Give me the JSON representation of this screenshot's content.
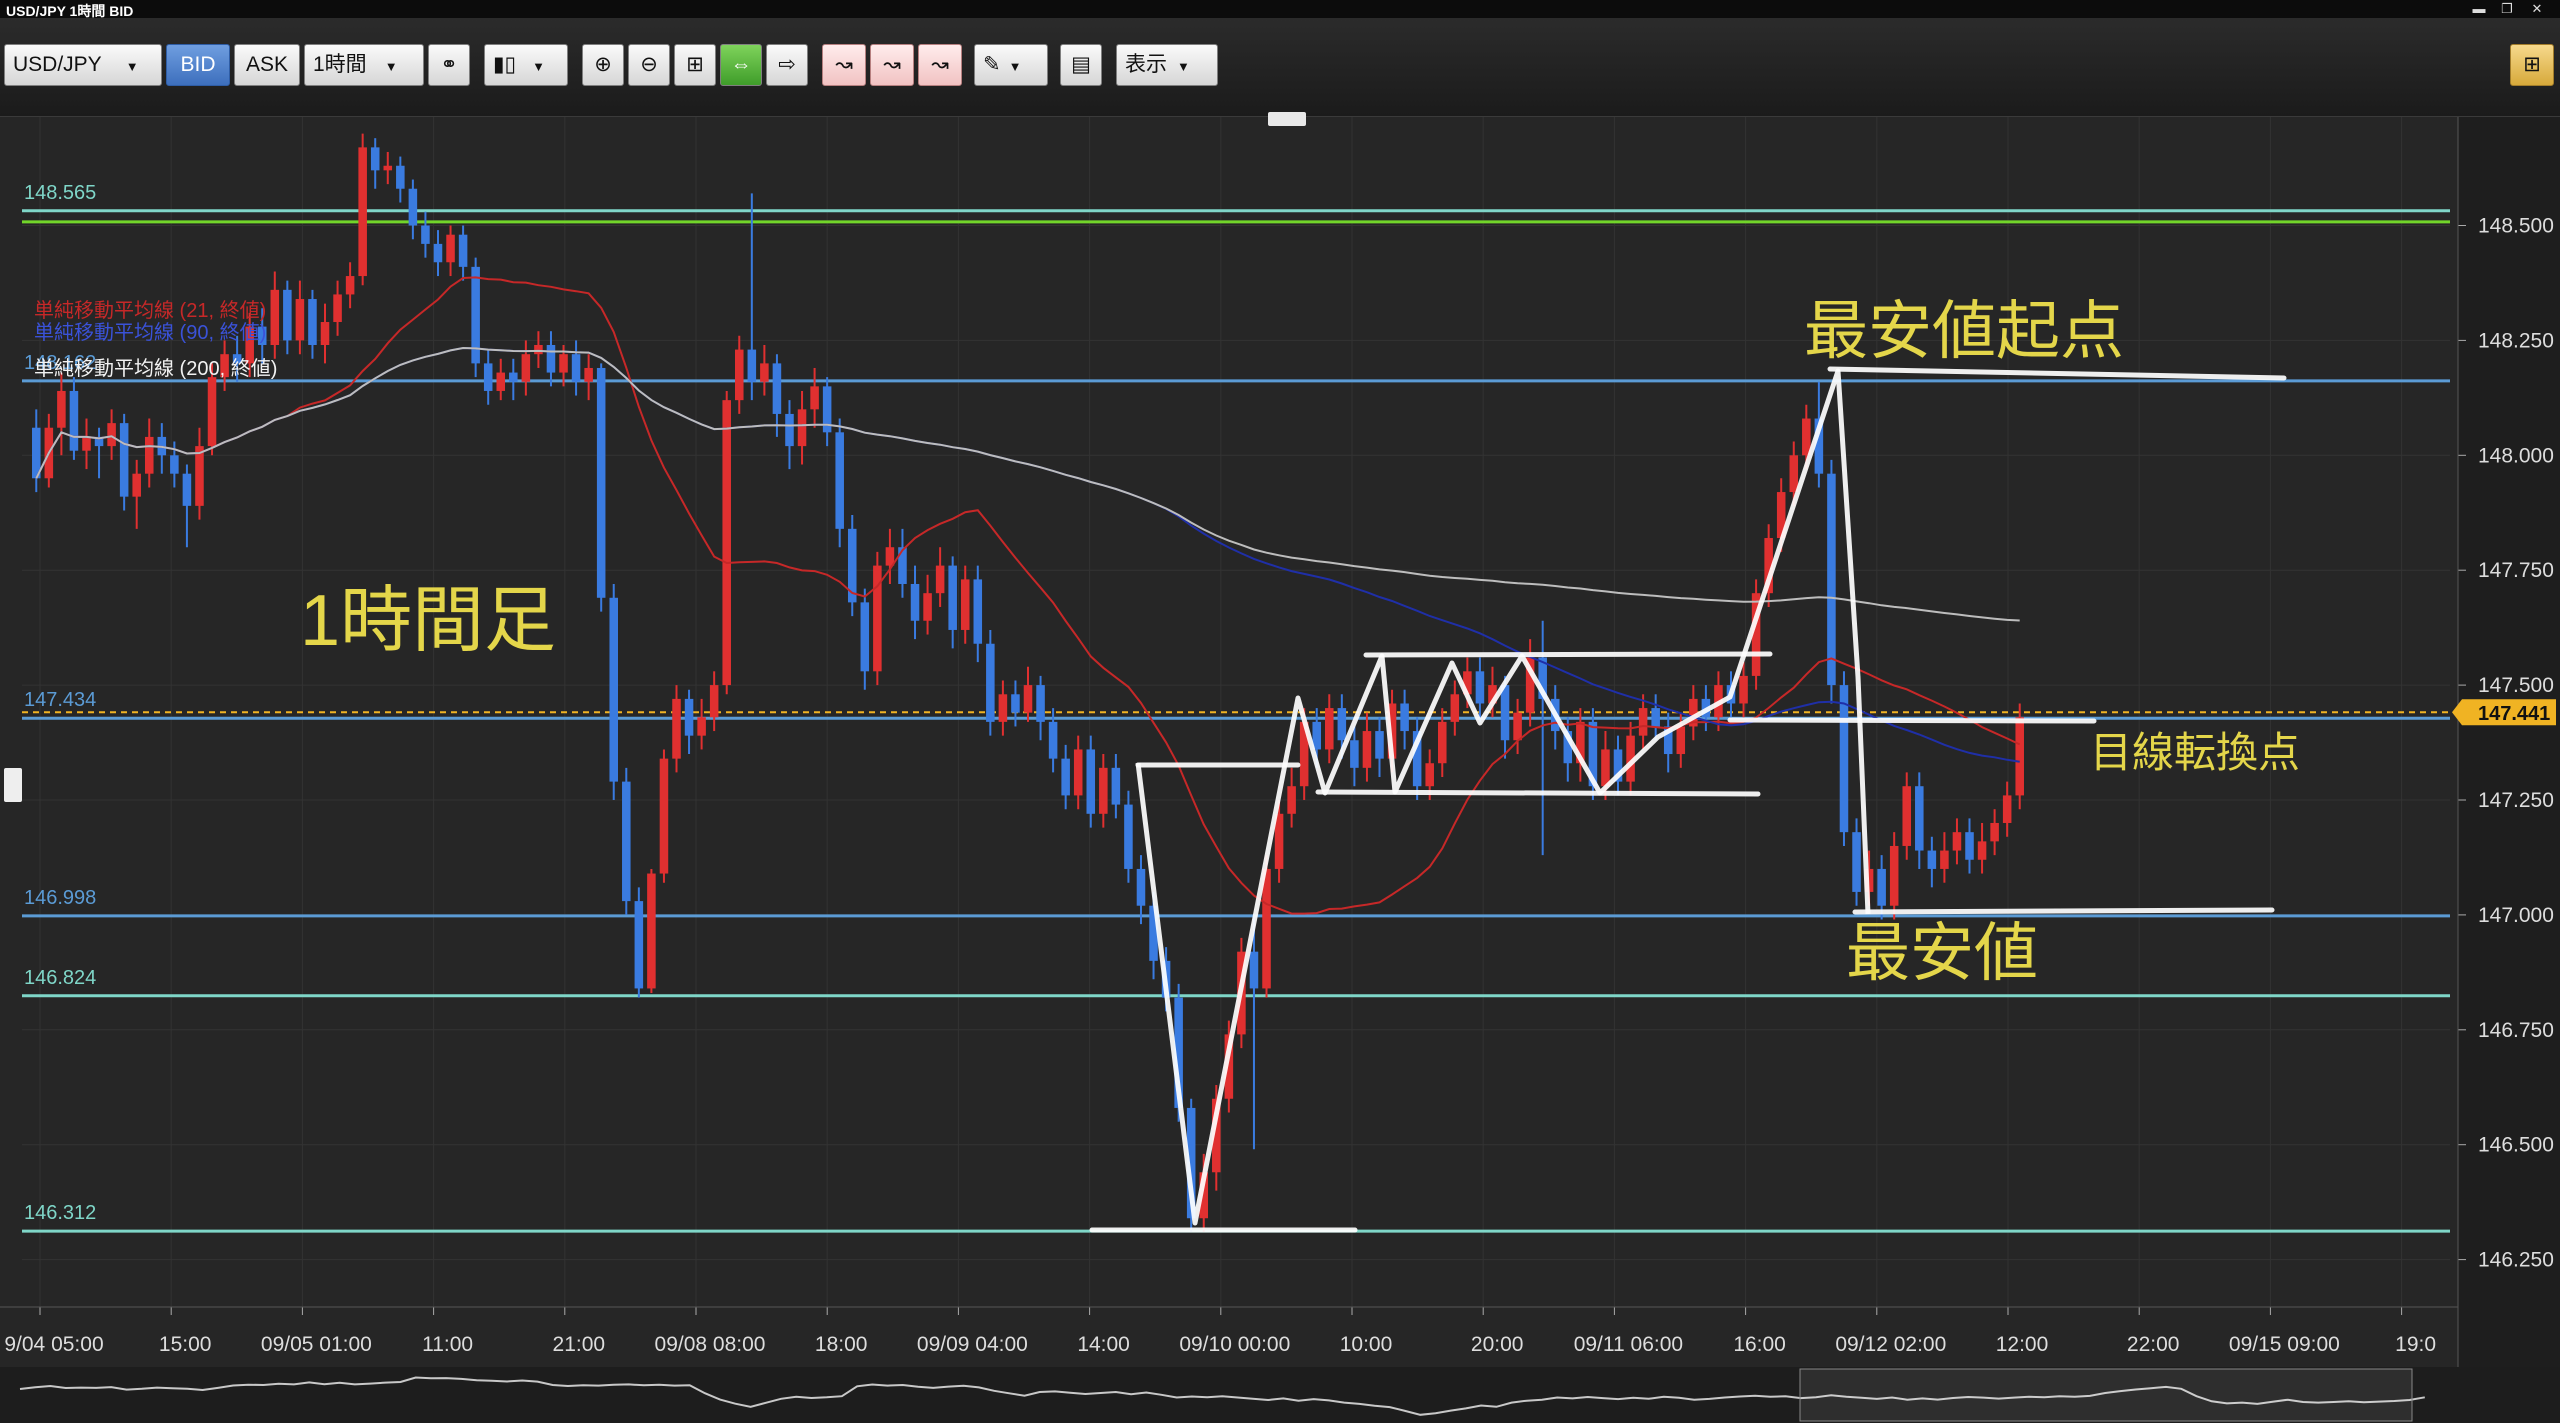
{
  "window": {
    "title": "USD/JPY 1時間 BID"
  },
  "toolbar": {
    "symbol": "USD/JPY",
    "bid_label": "BID",
    "ask_label": "ASK",
    "timeframe": "1時間",
    "display_label": "表示"
  },
  "legend": {
    "ma21": "単純移動平均線 (21, 終値)",
    "ma90": "単純移動平均線 (90, 終値)",
    "ma200": "単純移動平均線 (200, 終値)"
  },
  "annotations": {
    "timeframe_label": "1時間足",
    "lowest_start": "最安値起点",
    "trend_change": "目線転換点",
    "lowest": "最安値"
  },
  "colors": {
    "bull": "#e03030",
    "bear": "#3a7be0",
    "ma21": "#c62828",
    "ma90": "#1f2fa8",
    "ma200": "#bdbdbd",
    "hline_blue": "#5b9bd5",
    "hline_teal": "#7fd6c8",
    "hline_green": "#72d52a",
    "annotation_text": "#e4d64a",
    "drawn_lines": "#ffffff",
    "price_tag": "#f0b323"
  },
  "chart_data": {
    "type": "candlestick",
    "symbol": "USD/JPY",
    "y_ticks": [
      "148.500",
      "148.250",
      "148.000",
      "147.750",
      "147.500",
      "147.250",
      "147.000",
      "146.750",
      "146.500",
      "146.250"
    ],
    "ylim": [
      146.17,
      148.7
    ],
    "x_ticks": [
      "9/04 05:00",
      "15:00",
      "09/05 01:00",
      "11:00",
      "21:00",
      "09/08 08:00",
      "18:00",
      "09/09 04:00",
      "14:00",
      "09/10 00:00",
      "10:00",
      "20:00",
      "09/11 06:00",
      "16:00",
      "09/12 02:00",
      "12:00",
      "22:00",
      "09/15 09:00",
      "19:0"
    ],
    "current_price": "147.441",
    "horizontal_lines": [
      {
        "label": "148.565",
        "value": 148.532,
        "color": "teal"
      },
      {
        "label": "",
        "value": 148.508,
        "color": "green"
      },
      {
        "label": "148.162",
        "value": 148.162,
        "color": "blue"
      },
      {
        "label": "147.434",
        "value": 147.428,
        "color": "blue"
      },
      {
        "label": "146.998",
        "value": 146.998,
        "color": "blue"
      },
      {
        "label": "146.824",
        "value": 146.824,
        "color": "teal"
      },
      {
        "label": "146.312",
        "value": 146.312,
        "color": "teal"
      }
    ],
    "candles": [
      [
        148.06,
        147.95,
        148.1,
        147.92
      ],
      [
        147.95,
        148.06,
        148.09,
        147.93
      ],
      [
        148.06,
        148.14,
        148.18,
        148.0
      ],
      [
        148.14,
        148.01,
        148.17,
        147.99
      ],
      [
        148.01,
        148.04,
        148.08,
        147.97
      ],
      [
        148.04,
        148.02,
        148.06,
        147.95
      ],
      [
        148.02,
        148.07,
        148.1,
        147.99
      ],
      [
        148.07,
        147.91,
        148.09,
        147.88
      ],
      [
        147.91,
        147.96,
        147.99,
        147.84
      ],
      [
        147.96,
        148.04,
        148.08,
        147.93
      ],
      [
        148.04,
        148.0,
        148.07,
        147.96
      ],
      [
        148.0,
        147.96,
        148.03,
        147.93
      ],
      [
        147.96,
        147.89,
        147.98,
        147.8
      ],
      [
        147.89,
        148.02,
        148.06,
        147.86
      ],
      [
        148.02,
        148.17,
        148.2,
        148.0
      ],
      [
        148.17,
        148.22,
        148.25,
        148.14
      ],
      [
        148.22,
        148.2,
        148.26,
        148.16
      ],
      [
        148.2,
        148.28,
        148.31,
        148.17
      ],
      [
        148.28,
        148.24,
        148.32,
        148.2
      ],
      [
        148.24,
        148.36,
        148.4,
        148.21
      ],
      [
        148.36,
        148.25,
        148.38,
        148.22
      ],
      [
        148.25,
        148.34,
        148.38,
        148.22
      ],
      [
        148.34,
        148.24,
        148.36,
        148.21
      ],
      [
        148.24,
        148.29,
        148.33,
        148.2
      ],
      [
        148.29,
        148.35,
        148.38,
        148.26
      ],
      [
        148.35,
        148.39,
        148.42,
        148.32
      ],
      [
        148.39,
        148.67,
        148.7,
        148.37
      ],
      [
        148.67,
        148.62,
        148.69,
        148.58
      ],
      [
        148.62,
        148.63,
        148.66,
        148.59
      ],
      [
        148.63,
        148.58,
        148.65,
        148.55
      ],
      [
        148.58,
        148.5,
        148.6,
        148.47
      ],
      [
        148.5,
        148.46,
        148.53,
        148.43
      ],
      [
        148.46,
        148.42,
        148.49,
        148.39
      ],
      [
        148.42,
        148.48,
        148.5,
        148.39
      ],
      [
        148.48,
        148.41,
        148.5,
        148.38
      ],
      [
        148.41,
        148.2,
        148.43,
        148.17
      ],
      [
        148.2,
        148.14,
        148.23,
        148.11
      ],
      [
        148.14,
        148.18,
        148.21,
        148.12
      ],
      [
        148.18,
        148.16,
        148.21,
        148.12
      ],
      [
        148.16,
        148.22,
        148.25,
        148.13
      ],
      [
        148.22,
        148.24,
        148.27,
        148.19
      ],
      [
        148.24,
        148.18,
        148.27,
        148.15
      ],
      [
        148.18,
        148.22,
        148.24,
        148.15
      ],
      [
        148.22,
        148.16,
        148.25,
        148.13
      ],
      [
        148.16,
        148.19,
        148.22,
        148.12
      ],
      [
        148.19,
        147.69,
        148.2,
        147.66
      ],
      [
        147.69,
        147.29,
        147.72,
        147.25
      ],
      [
        147.29,
        147.03,
        147.32,
        147.0
      ],
      [
        147.03,
        146.84,
        147.06,
        146.82
      ],
      [
        146.84,
        147.09,
        147.1,
        146.83
      ],
      [
        147.09,
        147.34,
        147.36,
        147.07
      ],
      [
        147.34,
        147.47,
        147.5,
        147.31
      ],
      [
        147.47,
        147.39,
        147.49,
        147.35
      ],
      [
        147.39,
        147.43,
        147.47,
        147.36
      ],
      [
        147.43,
        147.5,
        147.53,
        147.4
      ],
      [
        147.5,
        148.12,
        148.14,
        147.48
      ],
      [
        148.12,
        148.23,
        148.26,
        148.09
      ],
      [
        148.23,
        148.16,
        148.57,
        148.12
      ],
      [
        148.16,
        148.2,
        148.24,
        148.13
      ],
      [
        148.2,
        148.09,
        148.22,
        148.04
      ],
      [
        148.09,
        148.02,
        148.12,
        147.97
      ],
      [
        148.02,
        148.1,
        148.14,
        147.98
      ],
      [
        148.1,
        148.15,
        148.19,
        148.06
      ],
      [
        148.15,
        148.05,
        148.17,
        148.02
      ],
      [
        148.05,
        147.84,
        148.08,
        147.8
      ],
      [
        147.84,
        147.68,
        147.87,
        147.65
      ],
      [
        147.68,
        147.53,
        147.71,
        147.49
      ],
      [
        147.53,
        147.76,
        147.79,
        147.5
      ],
      [
        147.76,
        147.8,
        147.84,
        147.72
      ],
      [
        147.8,
        147.72,
        147.84,
        147.69
      ],
      [
        147.72,
        147.64,
        147.76,
        147.6
      ],
      [
        147.64,
        147.7,
        147.74,
        147.61
      ],
      [
        147.7,
        147.76,
        147.8,
        147.67
      ],
      [
        147.76,
        147.62,
        147.78,
        147.58
      ],
      [
        147.62,
        147.73,
        147.76,
        147.59
      ],
      [
        147.73,
        147.59,
        147.76,
        147.55
      ],
      [
        147.59,
        147.42,
        147.62,
        147.39
      ],
      [
        147.42,
        147.48,
        147.51,
        147.39
      ],
      [
        147.48,
        147.44,
        147.51,
        147.41
      ],
      [
        147.44,
        147.5,
        147.54,
        147.42
      ],
      [
        147.5,
        147.42,
        147.52,
        147.38
      ],
      [
        147.42,
        147.34,
        147.45,
        147.31
      ],
      [
        147.34,
        147.26,
        147.37,
        147.23
      ],
      [
        147.26,
        147.36,
        147.39,
        147.23
      ],
      [
        147.36,
        147.22,
        147.39,
        147.19
      ],
      [
        147.22,
        147.32,
        147.35,
        147.19
      ],
      [
        147.32,
        147.24,
        147.35,
        147.21
      ],
      [
        147.24,
        147.1,
        147.27,
        147.07
      ],
      [
        147.1,
        147.02,
        147.13,
        146.98
      ],
      [
        147.02,
        146.9,
        147.05,
        146.86
      ],
      [
        146.9,
        146.82,
        146.93,
        146.79
      ],
      [
        146.82,
        146.58,
        146.85,
        146.55
      ],
      [
        146.58,
        146.34,
        146.6,
        146.31
      ],
      [
        146.34,
        146.44,
        146.48,
        146.31
      ],
      [
        146.44,
        146.6,
        146.63,
        146.4
      ],
      [
        146.6,
        146.74,
        146.77,
        146.57
      ],
      [
        146.74,
        146.92,
        146.95,
        146.71
      ],
      [
        146.92,
        146.84,
        147.0,
        146.49
      ],
      [
        146.84,
        147.1,
        147.13,
        146.82
      ],
      [
        147.1,
        147.22,
        147.25,
        147.07
      ],
      [
        147.22,
        147.28,
        147.32,
        147.19
      ],
      [
        147.28,
        147.42,
        147.45,
        147.25
      ],
      [
        147.42,
        147.36,
        147.45,
        147.32
      ],
      [
        147.36,
        147.45,
        147.48,
        147.33
      ],
      [
        147.45,
        147.38,
        147.48,
        147.34
      ],
      [
        147.38,
        147.32,
        147.41,
        147.28
      ],
      [
        147.32,
        147.4,
        147.44,
        147.29
      ],
      [
        147.4,
        147.34,
        147.43,
        147.3
      ],
      [
        147.34,
        147.46,
        147.49,
        147.31
      ],
      [
        147.46,
        147.4,
        147.49,
        147.36
      ],
      [
        147.4,
        147.28,
        147.43,
        147.25
      ],
      [
        147.28,
        147.33,
        147.36,
        147.25
      ],
      [
        147.33,
        147.42,
        147.45,
        147.3
      ],
      [
        147.42,
        147.48,
        147.51,
        147.39
      ],
      [
        147.48,
        147.53,
        147.56,
        147.45
      ],
      [
        147.53,
        147.46,
        147.56,
        147.42
      ],
      [
        147.46,
        147.5,
        147.54,
        147.43
      ],
      [
        147.5,
        147.38,
        147.52,
        147.34
      ],
      [
        147.38,
        147.44,
        147.47,
        147.35
      ],
      [
        147.44,
        147.56,
        147.6,
        147.41
      ],
      [
        147.56,
        147.47,
        147.64,
        147.13
      ],
      [
        147.47,
        147.4,
        147.5,
        147.36
      ],
      [
        147.4,
        147.33,
        147.43,
        147.29
      ],
      [
        147.33,
        147.42,
        147.45,
        147.29
      ],
      [
        147.42,
        147.28,
        147.45,
        147.25
      ],
      [
        147.28,
        147.36,
        147.4,
        147.25
      ],
      [
        147.36,
        147.29,
        147.39,
        147.26
      ],
      [
        147.29,
        147.39,
        147.42,
        147.26
      ],
      [
        147.39,
        147.45,
        147.48,
        147.36
      ],
      [
        147.45,
        147.41,
        147.48,
        147.38
      ],
      [
        147.41,
        147.35,
        147.44,
        147.31
      ],
      [
        147.35,
        147.41,
        147.44,
        147.32
      ],
      [
        147.41,
        147.47,
        147.5,
        147.38
      ],
      [
        147.47,
        147.43,
        147.5,
        147.4
      ],
      [
        147.43,
        147.5,
        147.53,
        147.4
      ],
      [
        147.5,
        147.46,
        147.53,
        147.43
      ],
      [
        147.46,
        147.52,
        147.55,
        147.43
      ],
      [
        147.52,
        147.7,
        147.73,
        147.49
      ],
      [
        147.7,
        147.82,
        147.85,
        147.67
      ],
      [
        147.82,
        147.92,
        147.95,
        147.79
      ],
      [
        147.92,
        148.0,
        148.03,
        147.89
      ],
      [
        148.0,
        148.08,
        148.11,
        147.97
      ],
      [
        148.08,
        147.96,
        148.16,
        147.93
      ],
      [
        147.96,
        147.5,
        147.99,
        147.46
      ],
      [
        147.5,
        147.18,
        147.53,
        147.15
      ],
      [
        147.18,
        147.05,
        147.21,
        147.02
      ],
      [
        147.05,
        147.1,
        147.14,
        147.02
      ],
      [
        147.1,
        147.02,
        147.13,
        146.99
      ],
      [
        147.02,
        147.15,
        147.18,
        146.99
      ],
      [
        147.15,
        147.28,
        147.31,
        147.12
      ],
      [
        147.28,
        147.14,
        147.31,
        147.1
      ],
      [
        147.14,
        147.1,
        147.17,
        147.06
      ],
      [
        147.1,
        147.14,
        147.18,
        147.07
      ],
      [
        147.14,
        147.18,
        147.21,
        147.11
      ],
      [
        147.18,
        147.12,
        147.21,
        147.09
      ],
      [
        147.12,
        147.16,
        147.2,
        147.09
      ],
      [
        147.16,
        147.2,
        147.23,
        147.13
      ],
      [
        147.2,
        147.26,
        147.29,
        147.17
      ],
      [
        147.26,
        147.43,
        147.46,
        147.23
      ]
    ]
  }
}
